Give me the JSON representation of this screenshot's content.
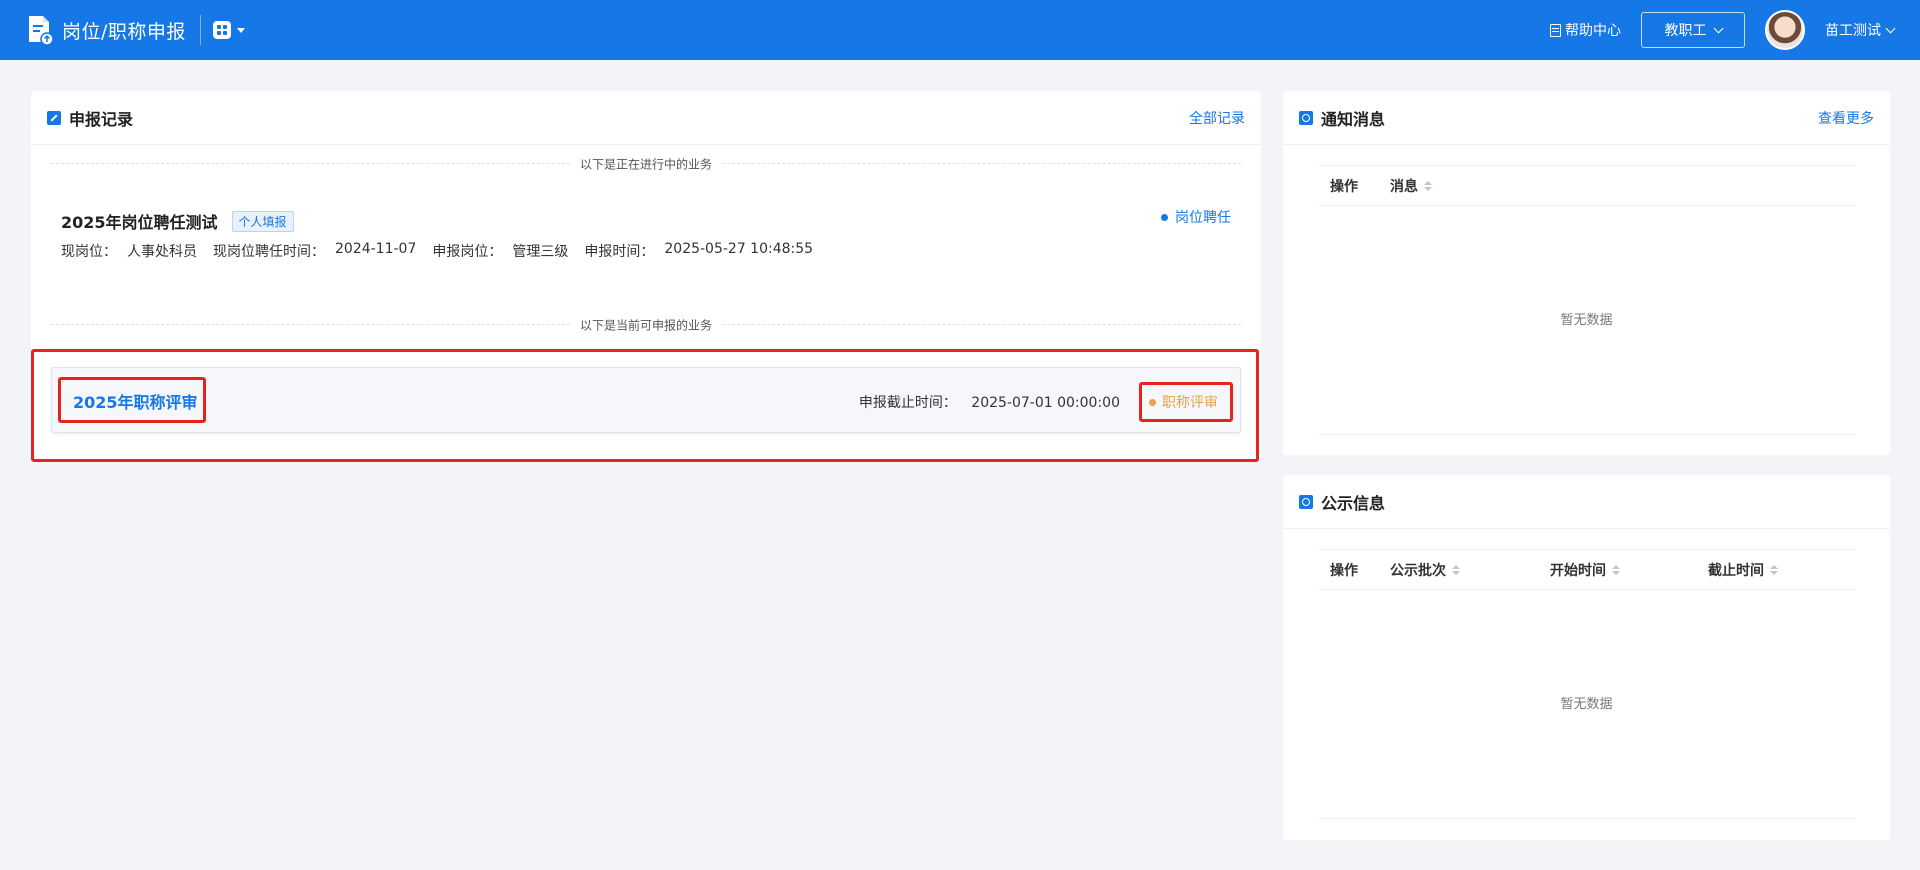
{
  "header": {
    "app_title": "岗位/职称申报",
    "help_label": "帮助中心",
    "role_selected": "教职工",
    "user_name": "苗工测试"
  },
  "records": {
    "title": "申报记录",
    "all_link": "全部记录",
    "in_progress_label": "以下是正在进行中的业务",
    "available_label": "以下是当前可申报的业务",
    "current": {
      "title": "2025年岗位聘任测试",
      "tag": "个人填报",
      "type": "岗位聘任",
      "meta": [
        {
          "key": "现岗位：",
          "value": "人事处科员"
        },
        {
          "key": "现岗位聘任时间：",
          "value": "2024-11-07"
        },
        {
          "key": "申报岗位：",
          "value": "管理三级"
        },
        {
          "key": "申报时间：",
          "value": "2025-05-27 10:48:55"
        }
      ]
    },
    "available": {
      "title": "2025年职称评审",
      "deadline_key": "申报截止时间：",
      "deadline_value": "2025-07-01 00:00:00",
      "type": "职称评审"
    }
  },
  "notice": {
    "title": "通知消息",
    "more_link": "查看更多",
    "columns": [
      "操作",
      "消息"
    ],
    "empty_text": "暂无数据"
  },
  "publicity": {
    "title": "公示信息",
    "columns": [
      "操作",
      "公示批次",
      "开始时间",
      "截止时间"
    ],
    "empty_text": "暂无数据"
  },
  "colors": {
    "primary": "#1677e6",
    "highlight_red": "#e8231c",
    "status_orange": "#e8a24a"
  }
}
